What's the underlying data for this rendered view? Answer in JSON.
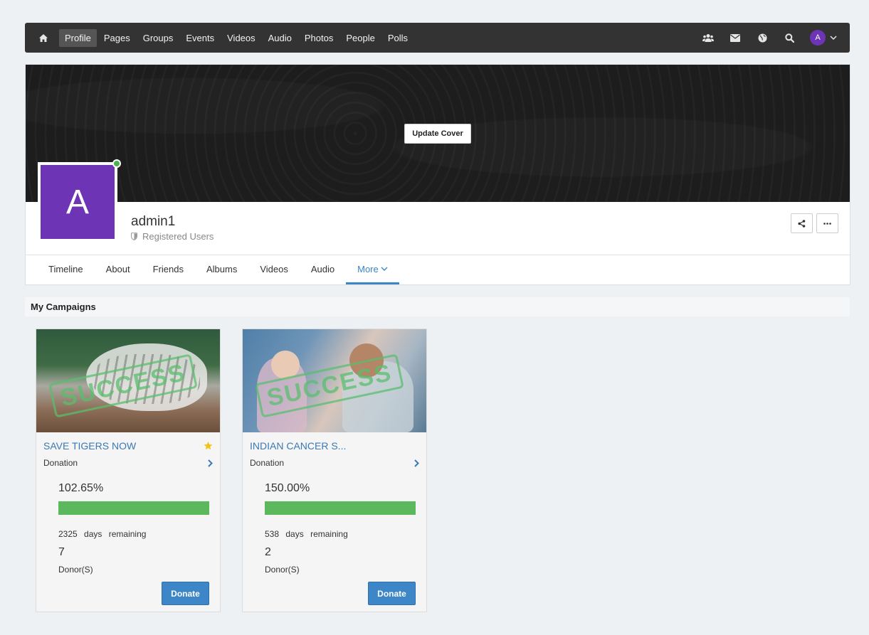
{
  "navbar": {
    "items": [
      "Profile",
      "Pages",
      "Groups",
      "Events",
      "Videos",
      "Audio",
      "Photos",
      "People",
      "Polls"
    ],
    "active": "Profile",
    "icons": [
      "home-icon",
      "users-icon",
      "envelope-icon",
      "globe-icon",
      "search-icon"
    ],
    "avatar_letter": "A"
  },
  "profile": {
    "update_cover_label": "Update Cover",
    "avatar_letter": "A",
    "avatar_color": "#6d35b5",
    "online_status_color": "#4caf50",
    "username": "admin1",
    "role": "Registered Users",
    "tabs": [
      "Timeline",
      "About",
      "Friends",
      "Albums",
      "Videos",
      "Audio",
      "More"
    ],
    "active_tab": "More"
  },
  "section": {
    "title": "My Campaigns"
  },
  "campaigns": [
    {
      "title": "SAVE TIGERS NOW",
      "type": "Donation",
      "featured": true,
      "stamp": "SUCCESS",
      "percent": "102.65%",
      "progress_fraction": 1.0,
      "days": "2325",
      "days_label": "days",
      "remaining_label": "remaining",
      "donors": "7",
      "donors_label": "Donor(S)",
      "donate_label": "Donate"
    },
    {
      "title": "INDIAN CANCER S...",
      "type": "Donation",
      "featured": false,
      "stamp": "SUCCESS",
      "percent": "150.00%",
      "progress_fraction": 1.0,
      "days": "538",
      "days_label": "days",
      "remaining_label": "remaining",
      "donors": "2",
      "donors_label": "Donor(S)",
      "donate_label": "Donate"
    }
  ],
  "colors": {
    "accent": "#3b86c6",
    "progress": "#5cb85c",
    "navbar": "#333333"
  }
}
